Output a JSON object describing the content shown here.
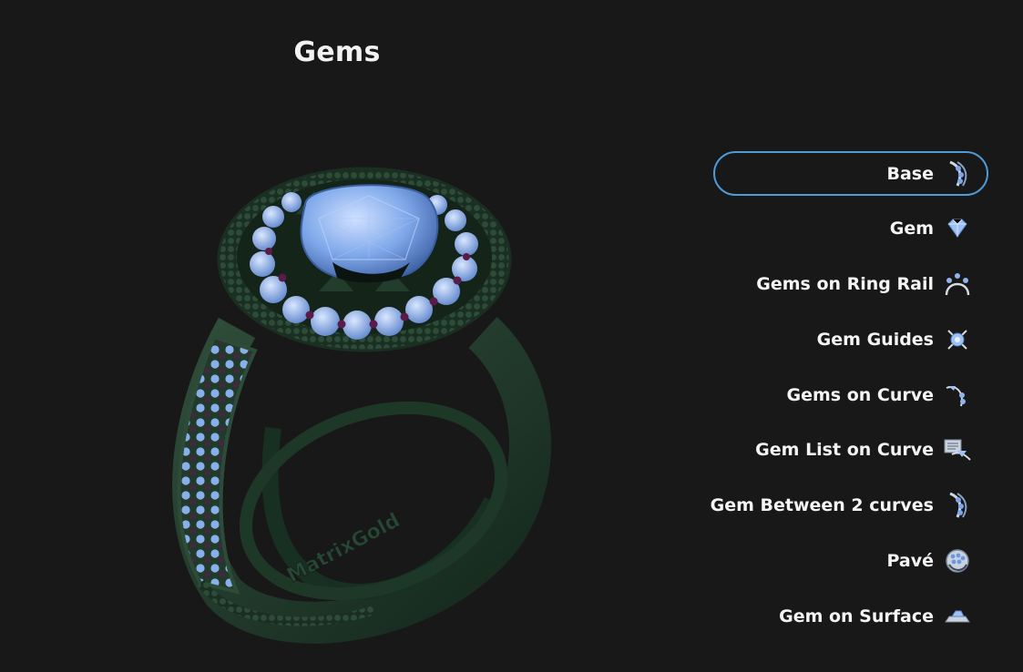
{
  "header": {
    "title": "Gems"
  },
  "viewport": {
    "engraving": "MatrixGold"
  },
  "menu": {
    "items": [
      {
        "label": "Base",
        "icon": "gem-between-curves-icon",
        "selected": true
      },
      {
        "label": "Gem",
        "icon": "gem-icon",
        "selected": false
      },
      {
        "label": "Gems on Ring Rail",
        "icon": "gems-on-ring-rail-icon",
        "selected": false
      },
      {
        "label": "Gem Guides",
        "icon": "gem-guides-icon",
        "selected": false
      },
      {
        "label": "Gems on Curve",
        "icon": "gems-on-curve-icon",
        "selected": false
      },
      {
        "label": "Gem List on Curve",
        "icon": "gem-list-on-curve-icon",
        "selected": false
      },
      {
        "label": "Gem Between 2 curves",
        "icon": "gem-between-curves-icon",
        "selected": false
      },
      {
        "label": "Pavé",
        "icon": "pave-icon",
        "selected": false
      },
      {
        "label": "Gem on Surface",
        "icon": "gem-on-surface-icon",
        "selected": false
      }
    ]
  },
  "colors": {
    "background": "#181818",
    "accent": "#4d9bd8",
    "metal": "#1f3a2a",
    "gem": "#8ab4f0",
    "accent_gem": "#5a1a4a"
  }
}
